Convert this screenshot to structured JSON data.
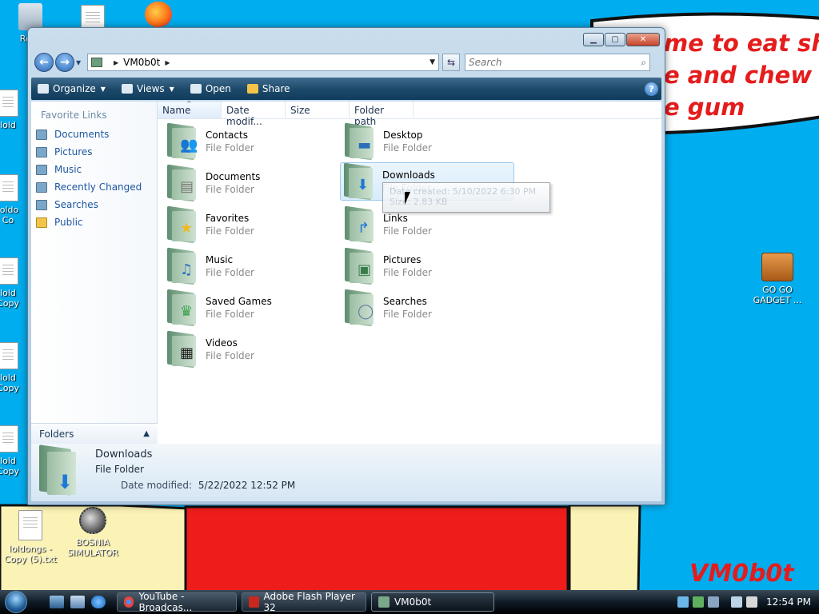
{
  "desktop": {
    "speech_text": "me to eat shit\ne and chew\ne gum",
    "signature": "VM0b0t",
    "icons": {
      "recycle": "Recy",
      "file1": "lold",
      "file2": "loldo\nCo",
      "file3": "lold\nCopy",
      "file4": "lold\nCopy",
      "file5": "lold\nCopy",
      "loldongs": "loldongs -\nCopy (5).txt",
      "bosnia": "BOSNIA\nSIMULATOR",
      "gadget": "GO GO\nGADGET ..."
    }
  },
  "window": {
    "address": {
      "location": "VM0b0t"
    },
    "search": {
      "placeholder": "Search"
    },
    "toolbar": {
      "organize": "Organize",
      "views": "Views",
      "open": "Open",
      "share": "Share",
      "help": "?"
    },
    "nav": {
      "heading": "Favorite Links",
      "links": [
        "Documents",
        "Pictures",
        "Music",
        "Recently Changed",
        "Searches",
        "Public"
      ],
      "folders_label": "Folders"
    },
    "columns": [
      "Name",
      "Date modif...",
      "Size",
      "Folder path"
    ],
    "items": [
      {
        "name": "Contacts",
        "type": "File Folder",
        "icon": "contacts-icon"
      },
      {
        "name": "Desktop",
        "type": "File Folder",
        "icon": "desktop-icon"
      },
      {
        "name": "Documents",
        "type": "File Folder",
        "icon": "documents-icon"
      },
      {
        "name": "Downloads",
        "type": "File Folder",
        "icon": "downloads-icon"
      },
      {
        "name": "Favorites",
        "type": "File Folder",
        "icon": "star-icon"
      },
      {
        "name": "Links",
        "type": "File Folder",
        "icon": "link-arrow-icon"
      },
      {
        "name": "Music",
        "type": "File Folder",
        "icon": "music-icon"
      },
      {
        "name": "Pictures",
        "type": "File Folder",
        "icon": "pictures-icon"
      },
      {
        "name": "Saved Games",
        "type": "File Folder",
        "icon": "trophy-icon"
      },
      {
        "name": "Searches",
        "type": "File Folder",
        "icon": "magnifier-icon"
      },
      {
        "name": "Videos",
        "type": "File Folder",
        "icon": "film-icon"
      }
    ],
    "tooltip": {
      "line1": "Date created: 5/10/2022 6:30 PM",
      "line2": "Size: 2.83 KB"
    },
    "details": {
      "name": "Downloads",
      "type": "File Folder",
      "date_label": "Date modified:",
      "date_value": "5/22/2022 12:52 PM"
    }
  },
  "taskbar": {
    "tasks": [
      "YouTube - Broadcas...",
      "Adobe Flash Player 32",
      "VM0b0t"
    ],
    "clock": "12:54 PM"
  },
  "colors": {
    "desktop_bg": "#00aef0",
    "speech_red": "#e51c1c",
    "link_blue": "#1d56a0"
  }
}
